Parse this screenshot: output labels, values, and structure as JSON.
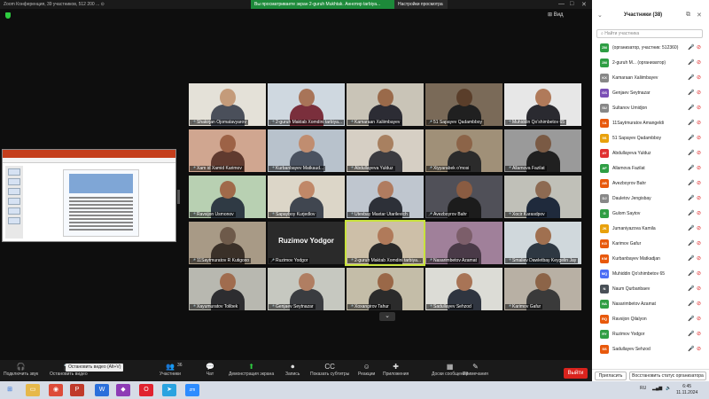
{
  "window": {
    "title": "Zoom Конференция, 39 участников, 512 200 ... ⊙",
    "share_banner": "Вы просматриваете экран 2-guruh Mukhtak. Аннотир tarbiya...",
    "share_options": "Настройки просмотра",
    "controls": [
      "—",
      "□",
      "✕"
    ],
    "view_label": "⊞ Вид"
  },
  "tiles": [
    {
      "name": "Shakirjan Ojomatavyarov",
      "bg": "#e4e1d8",
      "head": "#c49b7a",
      "body": "#4a4f5a"
    },
    {
      "name": "2-guruh Maktab Xomdini tarbiya...",
      "bg": "#cfd8e0",
      "head": "#a87458",
      "body": "#7a2f3c"
    },
    {
      "name": "Kamaraan Xaliimbayev",
      "bg": "#c9c4b7",
      "head": "#9a6a4a",
      "body": "#2c2c34"
    },
    {
      "name": "51 Sapayev Qadambboy",
      "bg": "#7a6a58",
      "head": "#5a3e2a",
      "body": "#202020"
    },
    {
      "name": "Muhiddin Qo'shimbetov 65",
      "bg": "#e7e7e7",
      "head": "#b07a5a",
      "body": "#2a2a30"
    },
    {
      "name": "Xam id Xamid Karimov",
      "bg": "#d0a690",
      "head": "#9d6246",
      "body": "#603a2f"
    },
    {
      "name": "Kurbanbayev Matkaud...",
      "bg": "#b8c2cc",
      "head": "#c08d70",
      "body": "#4a5260"
    },
    {
      "name": "Abdullayeva Yulduz",
      "bg": "#d6cfc4",
      "head": "#a88060",
      "body": "#3b3b40"
    },
    {
      "name": "Xiyyarabek o'mosi",
      "bg": "#a09078",
      "head": "#8c6448",
      "body": "#2b2b2b"
    },
    {
      "name": "Allamova Fazilat",
      "bg": "#9a9a9a",
      "head": "#7a5a44",
      "body": "#202020"
    },
    {
      "name": "Ravsijon Usmonov",
      "bg": "#b8d0b2",
      "head": "#a06a4a",
      "body": "#2f3a44"
    },
    {
      "name": "Sapayboy Kurjedlov",
      "bg": "#dcd6c8",
      "head": "#c08868",
      "body": "#404650"
    },
    {
      "name": "Utevbay Maxtar Utarilevich",
      "bg": "#bfc6cf",
      "head": "#b07c60",
      "body": "#2d3038"
    },
    {
      "name": "Avezboyrov Bahr",
      "bg": "#505058",
      "head": "#8a5c42",
      "body": "#1c1c1c"
    },
    {
      "name": "Xocir Karasdpov",
      "bg": "#c0c0b8",
      "head": "#8d6a52",
      "body": "#1f2a3c"
    },
    {
      "name": "11Saytmuratov R Kutigoxo",
      "bg": "#a89a86",
      "head": "#6e5a4a",
      "body": "#3a3028"
    },
    {
      "name": "Ruzimov Yodgor",
      "bg": "#2a2a2a",
      "head": "",
      "body": "",
      "center": "Ruzimov Yodgor"
    },
    {
      "name": "2-guruh Maktab Xomdini tarbiya...",
      "bg": "#cdbfa8",
      "head": "#b07a5a",
      "body": "#2a2a2a",
      "active": true
    },
    {
      "name": "Nasarimbetov Azamat",
      "bg": "#a0809a",
      "head": "#7c5e6a",
      "body": "#4a3a48"
    },
    {
      "name": "Smaliev Dawletbay Keygelin Jay",
      "bg": "#d0d8dc",
      "head": "#a07050",
      "body": "#2e3842"
    },
    {
      "name": "Xayumuratov Tolibek",
      "bg": "#b8b8b0",
      "head": "#a06c4e",
      "body": "#2d2d30"
    },
    {
      "name": "Genjaev Seytnazar",
      "bg": "#c6c8c0",
      "head": "#b07e62",
      "body": "#3a3c40"
    },
    {
      "name": "Xoxangirov Tahur",
      "bg": "#c4bda8",
      "head": "#9a6848",
      "body": "#2b2b2b"
    },
    {
      "name": "Sadullayev Sehzod",
      "bg": "#dcdcd6",
      "head": "#a87456",
      "body": "#2f3540"
    },
    {
      "name": "Karimov Gafur",
      "bg": "#b8b0a4",
      "head": "#8c6448",
      "body": "#3a3a3a"
    }
  ],
  "scroll_hint": "⌄",
  "panel": {
    "title": "Участники (38)",
    "search_placeholder": "Найти участника",
    "participants": [
      {
        "initials": "ZM",
        "color": "#2f9e44",
        "name": "(организатор, участник: 512360)"
      },
      {
        "initials": "2M",
        "color": "#2f9e44",
        "name": "2-guruh M... (организатор)"
      },
      {
        "initials": "KX",
        "color": "#888888",
        "name": "Kamaraan Xaliimbayev"
      },
      {
        "initials": "GS",
        "color": "#7a4fb5",
        "name": "Genjaev Seytnazar"
      },
      {
        "initials": "SU",
        "color": "#888888",
        "name": "Sultanov Umidjon"
      },
      {
        "initials": "1A",
        "color": "#e8590c",
        "name": "11Saytmuratov Amangeldi"
      },
      {
        "initials": "5S",
        "color": "#e8a10c",
        "name": "51 Sapayev Qadambboy"
      },
      {
        "initials": "AY",
        "color": "#e03131",
        "name": "Abdullayeva Yulduz"
      },
      {
        "initials": "AF",
        "color": "#2f9e44",
        "name": "Allamova Fazilat"
      },
      {
        "initials": "AB",
        "color": "#e8590c",
        "name": "Avezboyrov Bahr"
      },
      {
        "initials": "DJ",
        "color": "#888888",
        "name": "Dauletov Jengisbay"
      },
      {
        "initials": "G",
        "color": "#2f9e44",
        "name": "Gulom Saytov"
      },
      {
        "initials": "JK",
        "color": "#e8a10c",
        "name": "Jumaniyazova Kamila"
      },
      {
        "initials": "KG",
        "color": "#e8590c",
        "name": "Karimov Gafur"
      },
      {
        "initials": "KM",
        "color": "#e8590c",
        "name": "Kurbanbayev Matkadjan"
      },
      {
        "initials": "MQ",
        "color": "#4c6ef5",
        "name": "Muhiddin Qo'shimbetov 65"
      },
      {
        "initials": "N",
        "color": "#495057",
        "name": "Naum Qurbanbaev"
      },
      {
        "initials": "NA",
        "color": "#2f9e44",
        "name": "Nasarimbetov Azamat"
      },
      {
        "initials": "RQ",
        "color": "#e8590c",
        "name": "Ravsijon Qilalyon"
      },
      {
        "initials": "RY",
        "color": "#2f9e44",
        "name": "Ruzimov Yodgor"
      },
      {
        "initials": "SS",
        "color": "#e8590c",
        "name": "Sadullayev Sehzod"
      }
    ],
    "invite": "Пригласить",
    "reclaim": "Восстановить статус организатора"
  },
  "toolbar": {
    "items": [
      {
        "icon": "🎧",
        "label": "Подключить звук"
      },
      {
        "icon": "📷",
        "label": "Остановить видео"
      },
      {
        "icon": "👥",
        "label": "Участники"
      },
      {
        "icon": "💬",
        "label": "Чат"
      },
      {
        "icon": "⬆",
        "label": "Демонстрация экрана"
      },
      {
        "icon": "⏺",
        "label": "Запись"
      },
      {
        "icon": "CC",
        "label": "Показать субтитры"
      },
      {
        "icon": "☺",
        "label": "Реакции"
      },
      {
        "icon": "✚",
        "label": "Приложения"
      },
      {
        "icon": "▦",
        "label": "Доски сообщений"
      },
      {
        "icon": "✎",
        "label": "Примечания"
      }
    ],
    "participant_count": "36",
    "tooltip": "Остановить видео (Alt+V)",
    "leave": "Выйти"
  },
  "taskbar": {
    "lang": "RU",
    "time": "6:45",
    "date": "11.11.2024"
  }
}
